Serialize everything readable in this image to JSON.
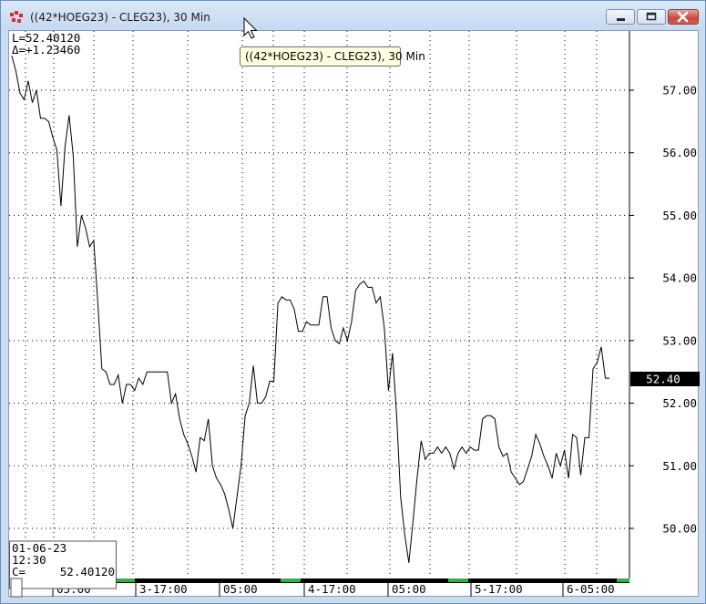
{
  "window": {
    "title": "((42*HOEG23) - CLEG23), 30 Min",
    "icon": "chart-app-icon",
    "buttons": [
      "minimize",
      "maximize",
      "close"
    ]
  },
  "tooltip": {
    "text": "((42*HOEG23) - CLEG23), 30 Min"
  },
  "readout": {
    "last": "L=52.40120",
    "delta": "Δ=+1.23460"
  },
  "info_box": {
    "date": "01-06-23",
    "time": "12:30",
    "close_label": "C=",
    "close_value": "52.40120"
  },
  "price_axis": {
    "ticks": [
      "57.00",
      "56.00",
      "55.00",
      "54.00",
      "53.00",
      "52.00",
      "51.00",
      "50.00"
    ],
    "current_price": "52.40"
  },
  "time_axis": {
    "labels": [
      "05:00",
      "3-17:00",
      "05:00",
      "4-17:00",
      "05:00",
      "5-17:00",
      "6-05:00"
    ]
  },
  "colors": {
    "line": "#000000",
    "price_tag_bg": "#000000",
    "session_marker": "#2fb24a",
    "grid": "#000000"
  },
  "chart_data": {
    "type": "line",
    "title": "((42*HOEG23) - CLEG23), 30 Min",
    "ylim": [
      49.5,
      57.5
    ],
    "x_labels": [
      "05:00",
      "3-17:00",
      "05:00",
      "4-17:00",
      "05:00",
      "5-17:00",
      "6-05:00"
    ],
    "values": [
      57.55,
      57.3,
      56.95,
      56.85,
      57.15,
      56.8,
      57.0,
      56.55,
      56.55,
      56.5,
      56.25,
      56.05,
      55.15,
      56.1,
      56.6,
      55.95,
      54.5,
      55.0,
      54.8,
      54.5,
      54.6,
      53.6,
      52.55,
      52.5,
      52.3,
      52.3,
      52.45,
      52.0,
      52.3,
      52.3,
      52.2,
      52.4,
      52.3,
      52.5,
      52.5,
      52.5,
      52.5,
      52.5,
      52.5,
      52.0,
      52.15,
      51.75,
      51.5,
      51.35,
      51.15,
      50.9,
      51.45,
      51.4,
      51.75,
      51.0,
      50.8,
      50.7,
      50.55,
      50.3,
      50.0,
      50.5,
      51.0,
      51.8,
      52.0,
      52.6,
      52.0,
      52.0,
      52.1,
      52.35,
      52.35,
      53.6,
      53.7,
      53.65,
      53.65,
      53.5,
      53.15,
      53.15,
      53.3,
      53.25,
      53.25,
      53.25,
      53.7,
      53.7,
      53.2,
      53.0,
      52.95,
      53.2,
      53.0,
      53.3,
      53.8,
      53.9,
      53.95,
      53.85,
      53.85,
      53.6,
      53.7,
      53.2,
      52.2,
      52.8,
      51.8,
      50.5,
      49.9,
      49.45,
      50.1,
      50.8,
      51.4,
      51.1,
      51.2,
      51.2,
      51.3,
      51.2,
      51.3,
      51.2,
      50.95,
      51.2,
      51.3,
      51.2,
      51.3,
      51.25,
      51.25,
      51.75,
      51.8,
      51.8,
      51.75,
      51.3,
      51.15,
      51.2,
      50.9,
      50.8,
      50.7,
      50.75,
      50.95,
      51.15,
      51.5,
      51.35,
      51.15,
      51.0,
      50.8,
      51.2,
      51.0,
      51.25,
      50.8,
      51.5,
      51.45,
      50.85,
      51.45,
      51.45,
      52.55,
      52.65,
      52.9,
      52.4,
      52.4
    ]
  }
}
